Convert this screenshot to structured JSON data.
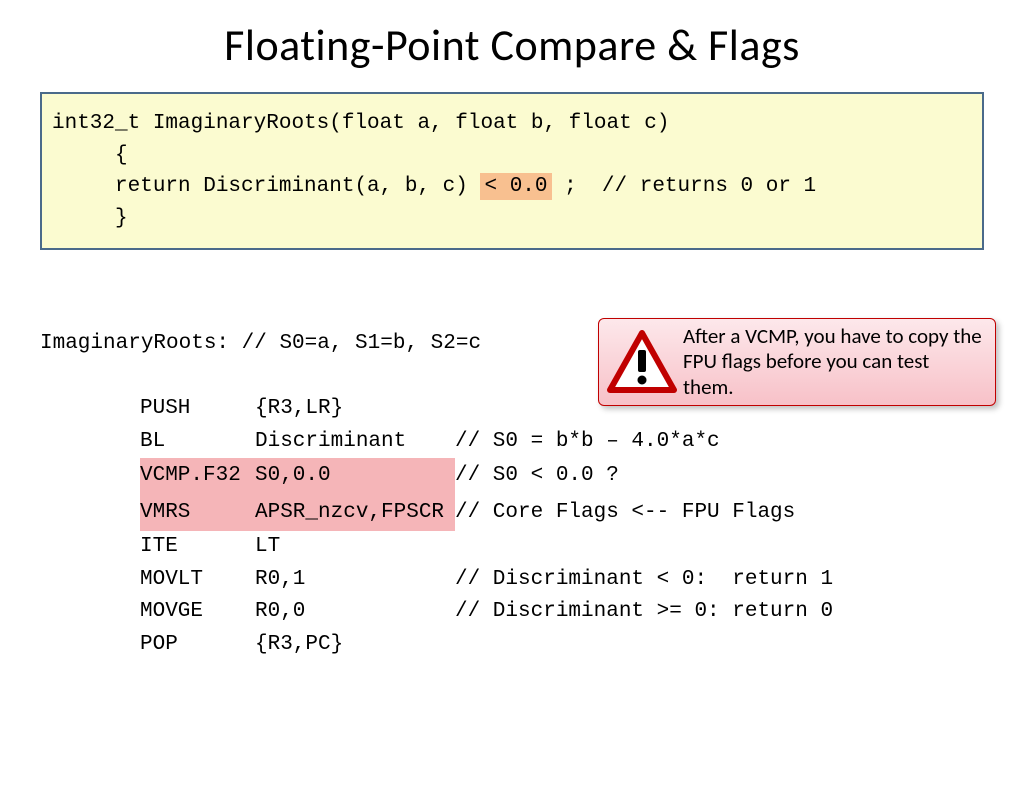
{
  "title": "Floating-Point Compare & Flags",
  "codebox": {
    "l1a": "int32_t ImaginaryRoots(float a, float b, float c)",
    "l2": "     {",
    "l3a": "     return Discriminant(a, b, c) ",
    "l3hl": "< 0.0",
    "l3b": " ;  // returns 0 or 1",
    "l4": "     }"
  },
  "asm": {
    "header": "ImaginaryRoots: // S0=a, S1=b, S2=c",
    "rows": [
      {
        "op": "PUSH",
        "arg": "{R3,LR}",
        "cmt": ""
      },
      {
        "op": "BL",
        "arg": "Discriminant",
        "cmt": "// S0 = b*b – 4.0*a*c"
      },
      {
        "op": "VCMP.F32",
        "arg": "S0,0.0",
        "cmt": "// S0 < 0.0 ?",
        "hl": true
      },
      {
        "op": "VMRS",
        "arg": "APSR_nzcv,FPSCR",
        "cmt": "// Core Flags <-- FPU Flags",
        "hl": true
      },
      {
        "op": "ITE",
        "arg": "LT",
        "cmt": ""
      },
      {
        "op": "MOVLT",
        "arg": "R0,1",
        "cmt": "// Discriminant < 0:  return 1"
      },
      {
        "op": "MOVGE",
        "arg": "R0,0",
        "cmt": "// Discriminant >= 0: return 0"
      },
      {
        "op": "POP",
        "arg": "{R3,PC}",
        "cmt": ""
      }
    ]
  },
  "callout": {
    "text": "After a VCMP, you have to copy the FPU flags before you can test them."
  }
}
